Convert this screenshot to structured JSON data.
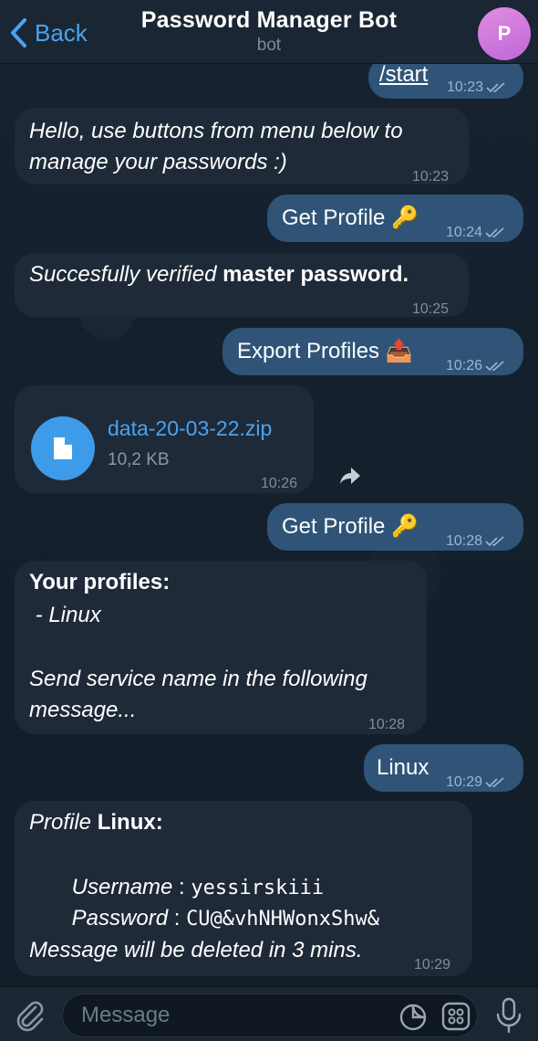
{
  "header": {
    "back_label": "Back",
    "title": "Password Manager Bot",
    "subtitle": "bot",
    "avatar_letter": "P",
    "avatar_color": "#d07ae0"
  },
  "messages": [
    {
      "dir": "out",
      "text": "/start",
      "time": "10:23"
    },
    {
      "dir": "in",
      "line1": "Hello, use buttons from menu below to",
      "line2": "manage your passwords :)",
      "time": "10:23"
    },
    {
      "dir": "out",
      "text": "Get Profile 🔑",
      "time": "10:24"
    },
    {
      "dir": "in",
      "italic": "Succesfully verified ",
      "bold": "master password.",
      "time": "10:25"
    },
    {
      "dir": "out",
      "text": "Export Profiles 📤",
      "time": "10:26"
    },
    {
      "dir": "in",
      "file_name": "data-20-03-22.zip",
      "file_size": "10,2 KB",
      "time": "10:26"
    },
    {
      "dir": "out",
      "text": "Get Profile 🔑",
      "time": "10:28"
    },
    {
      "dir": "in",
      "heading": "Your profiles:",
      "item": " - Linux",
      "line1": "Send service name in the following",
      "line2": "message...",
      "time": "10:28"
    },
    {
      "dir": "out",
      "text": "Linux",
      "time": "10:29"
    },
    {
      "dir": "in",
      "profile_label": "Profile ",
      "profile_name": "Linux:",
      "username_label": "Username",
      "username_value": "yessirskiii",
      "password_label": "Password",
      "password_value": "CU@&vhNHWonxShw&",
      "colon": " : ",
      "footer": "Message will be deleted in 3 mins.",
      "time": "10:29"
    }
  ],
  "input": {
    "placeholder": "Message"
  },
  "colors": {
    "accent": "#4aa3f0",
    "incoming_bubble": "#1f2a38",
    "outgoing_bubble": "#2f5478",
    "background": "#121d29"
  },
  "icons": [
    "back-chevron-icon",
    "double-check-icon",
    "file-icon",
    "forward-icon",
    "attach-icon",
    "sticker-icon",
    "commands-icon",
    "microphone-icon"
  ]
}
